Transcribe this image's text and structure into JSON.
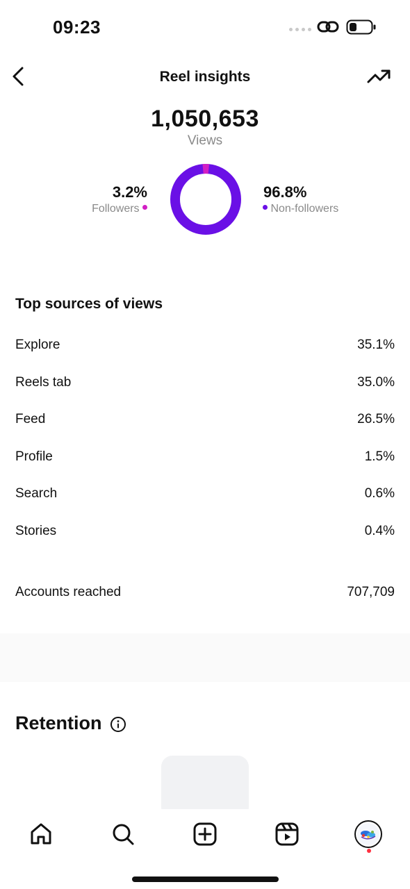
{
  "status_bar": {
    "time": "09:23"
  },
  "header": {
    "title": "Reel insights"
  },
  "summary": {
    "views_count": "1,050,653",
    "views_label": "Views",
    "followers_pct": "3.2%",
    "followers_label": "Followers",
    "followers_fraction": 0.032,
    "followers_color": "#d21fc4",
    "nonfollowers_pct": "96.8%",
    "nonfollowers_label": "Non-followers",
    "nonfollowers_fraction": 0.968,
    "nonfollowers_color": "#6a10e6"
  },
  "top_sources": {
    "title": "Top sources of views",
    "items": [
      {
        "name": "Explore",
        "value": "35.1%"
      },
      {
        "name": "Reels tab",
        "value": "35.0%"
      },
      {
        "name": "Feed",
        "value": "26.5%"
      },
      {
        "name": "Profile",
        "value": "1.5%"
      },
      {
        "name": "Search",
        "value": "0.6%"
      },
      {
        "name": "Stories",
        "value": "0.4%"
      }
    ]
  },
  "accounts_reached": {
    "label": "Accounts reached",
    "value": "707,709"
  },
  "retention": {
    "title": "Retention"
  },
  "nav": {
    "items": [
      "home-icon",
      "search-icon",
      "create-icon",
      "reels-icon",
      "profile-avatar"
    ]
  }
}
